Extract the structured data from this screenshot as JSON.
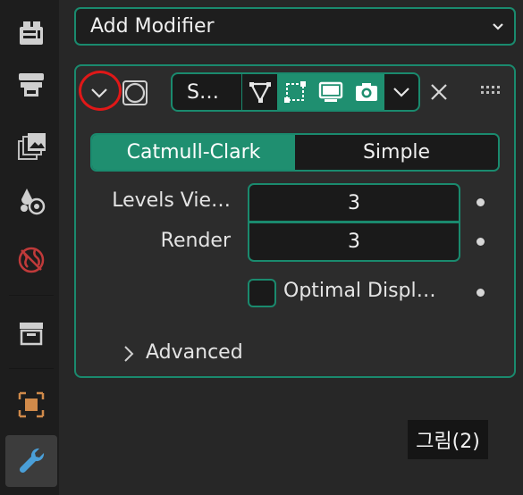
{
  "add_modifier": {
    "label": "Add Modifier",
    "icon": "chevron-down-icon"
  },
  "sidebar": {
    "tabs": [
      {
        "icon": "render-icon",
        "active": false
      },
      {
        "icon": "output-icon",
        "active": false
      },
      {
        "icon": "view-layer-icon",
        "active": false
      },
      {
        "icon": "scene-icon",
        "active": false
      },
      {
        "icon": "world-icon",
        "active": false
      },
      {
        "icon": "collection-icon",
        "active": false
      },
      {
        "icon": "object-icon",
        "active": false
      },
      {
        "icon": "modifier-wrench-icon",
        "active": true
      }
    ]
  },
  "modifier": {
    "name": "S…",
    "toggles": [
      "edit-cage-icon",
      "edit-mode-icon",
      "realtime-viewport-icon",
      "render-camera-icon"
    ],
    "subdivision_type": {
      "options": [
        "Catmull-Clark",
        "Simple"
      ],
      "selected": "Catmull-Clark"
    },
    "levels_viewport": {
      "label": "Levels Vie…",
      "value": "3"
    },
    "render_levels": {
      "label": "Render",
      "value": "3"
    },
    "optimal_display": {
      "label": "Optimal Displ…",
      "checked": false
    },
    "advanced": {
      "label": "Advanced"
    }
  },
  "colors": {
    "accent": "#1f8f70",
    "border": "#1a8a6e",
    "highlight_circle": "#e01818"
  },
  "caption": "그림(2)"
}
